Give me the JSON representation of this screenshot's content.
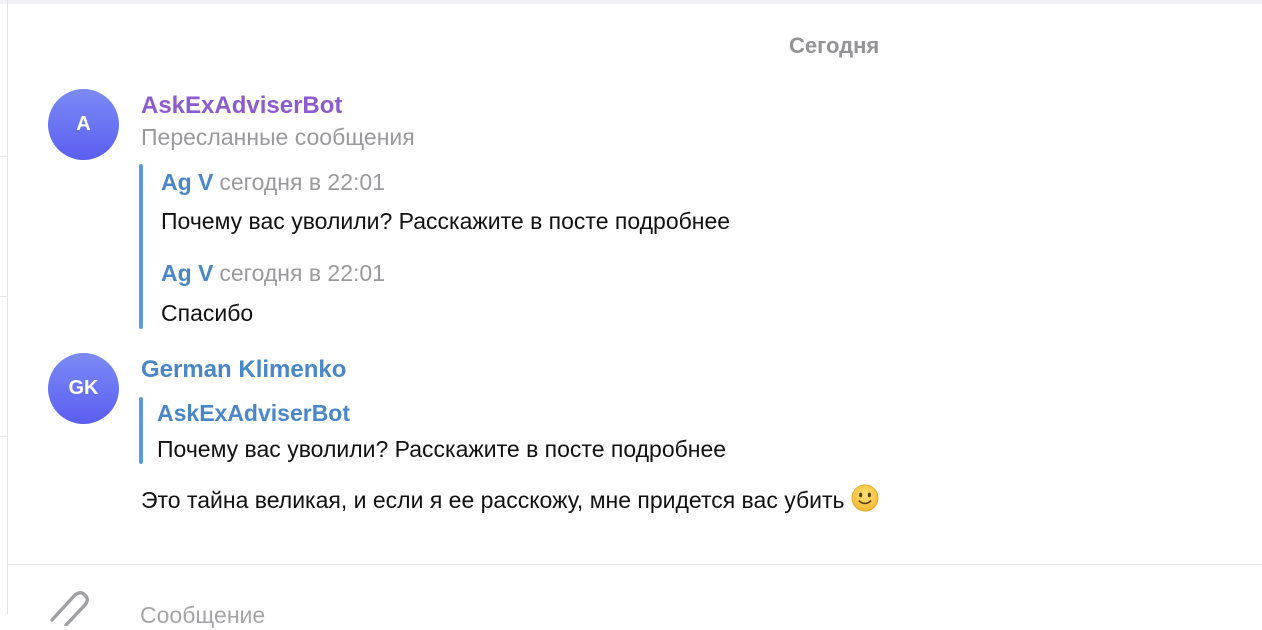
{
  "date_separator": "Сегодня",
  "messages": [
    {
      "avatar_initials": "A",
      "sender": "AskExAdviserBot",
      "sender_color": "#8b5bcf",
      "subtitle": "Пересланные сообщения",
      "forwarded": [
        {
          "author": "Ag V",
          "time": "сегодня в 22:01",
          "text": "Почему вас уволили? Расскажите в посте подробнее"
        },
        {
          "author": "Ag V",
          "time": "сегодня в 22:01",
          "text": "Спасибо"
        }
      ]
    },
    {
      "avatar_initials": "GK",
      "sender": "German Klimenko",
      "sender_color": "#4a87c9",
      "reply": {
        "author": "AskExAdviserBot",
        "text": "Почему вас уволили? Расскажите в посте подробнее"
      },
      "text": "Это тайна великая, и если я ее расскожу, мне придется вас убить",
      "emoji": "slightly-smiling-face"
    }
  ],
  "composer": {
    "placeholder": "Сообщение",
    "attach_icon": "paperclip-icon"
  },
  "colors": {
    "avatar_gradient_top": "#7b8bf5",
    "avatar_gradient_bottom": "#5b5ef0",
    "link_blue": "#4a87c9",
    "quote_bar": "#5b9bd8",
    "muted_gray": "#9a9a9d"
  }
}
